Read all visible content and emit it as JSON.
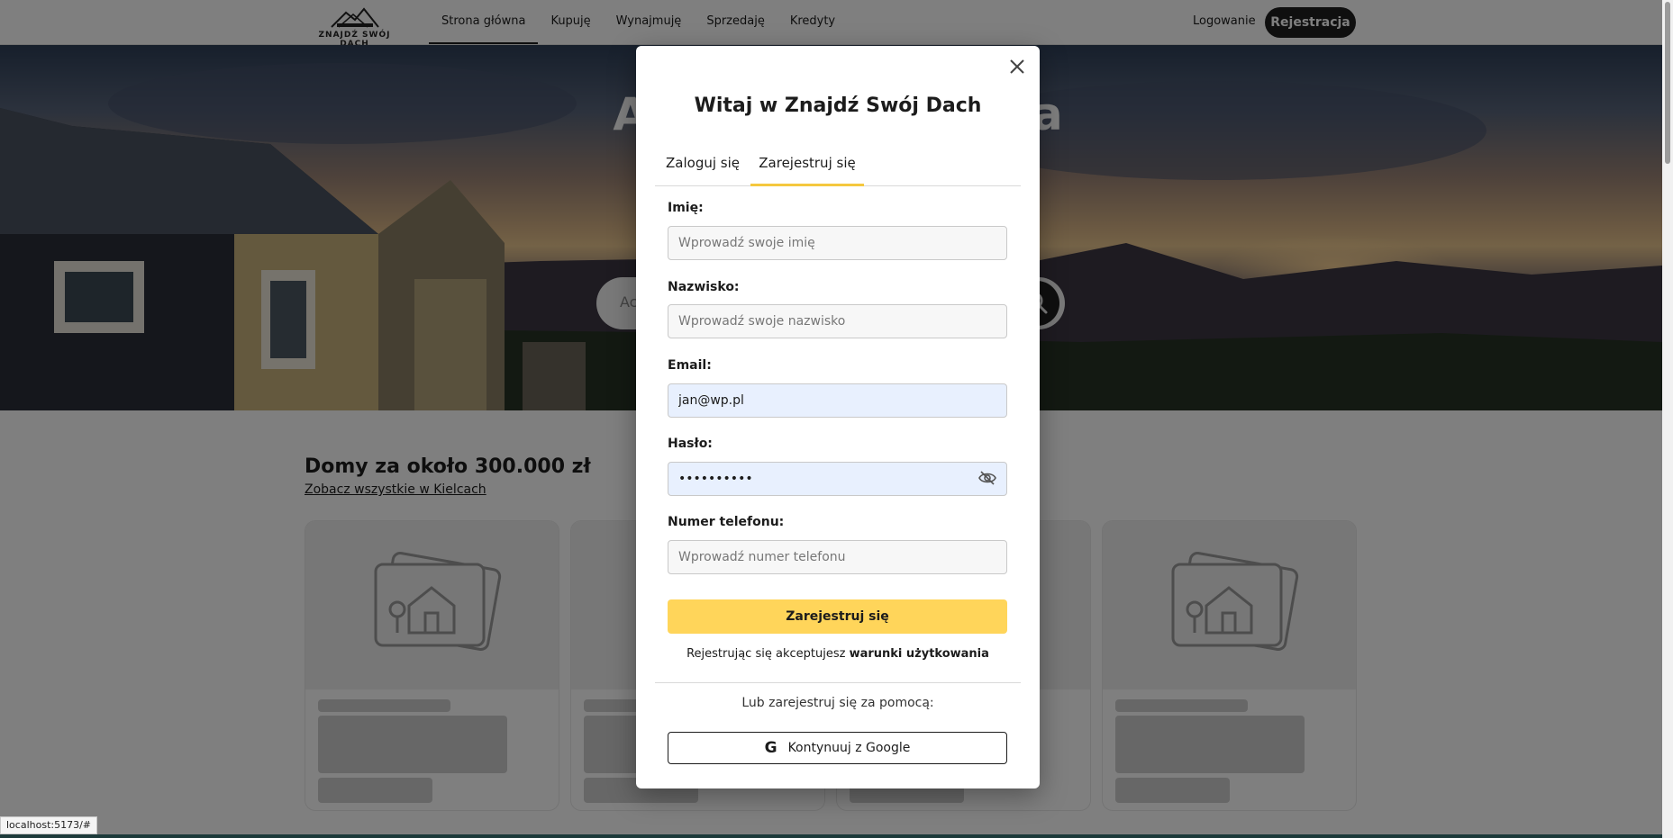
{
  "header": {
    "logo_text": "ZNAJDŹ SWÓJ DACH",
    "nav": [
      "Strona główna",
      "Kupuję",
      "Wynajmuję",
      "Sprzedaję",
      "Kredyty"
    ],
    "login": "Logowanie",
    "register": "Rejestracja"
  },
  "hero": {
    "title_visible_left": "Ac",
    "title_visible_right": "ia",
    "search_placeholder_visible": "Ac"
  },
  "section": {
    "title": "Domy za około 300.000 zł",
    "link": "Zobacz wszystkie w Kielcach"
  },
  "modal": {
    "title": "Witaj w Znajdź Swój Dach",
    "tabs": [
      "Zaloguj się",
      "Zarejestruj się"
    ],
    "active_tab": "Zarejestruj się",
    "fields": {
      "first_name": {
        "label": "Imię:",
        "placeholder": "Wprowadź swoje imię",
        "value": ""
      },
      "last_name": {
        "label": "Nazwisko:",
        "placeholder": "Wprowadź swoje nazwisko",
        "value": ""
      },
      "email": {
        "label": "Email:",
        "placeholder": "",
        "value": "jan@wp.pl"
      },
      "password": {
        "label": "Hasło:",
        "placeholder": "",
        "value": "••••••••••"
      },
      "phone": {
        "label": "Numer telefonu:",
        "placeholder": "Wprowadź numer telefonu",
        "value": ""
      }
    },
    "submit": "Zarejestruj się",
    "terms_prefix": "Rejestrując się akceptujesz",
    "terms_link": "warunki użytkowania",
    "alt_text": "Lub zarejestruj się za pomocą:",
    "google_glyph": "G",
    "google_button": "Kontynuuj z Google"
  },
  "status_bar": "localhost:5173/#",
  "colors": {
    "accent": "#ffd55a",
    "active_tab_underline": "#f5c83f",
    "dark_button": "#1f1f1f",
    "autofill_bg": "#e8f0fe"
  },
  "icons": [
    "close-icon",
    "eye-slash-icon",
    "google-icon",
    "house-photo-placeholder-icon",
    "search-icon",
    "logo-houses-icon"
  ]
}
